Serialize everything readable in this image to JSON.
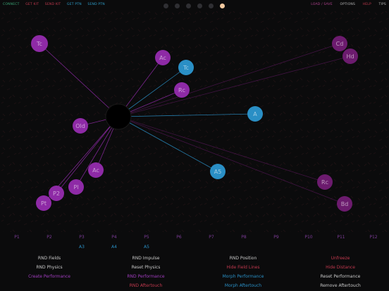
{
  "topbar": {
    "left": [
      {
        "label": "CONNECT",
        "color": "#3aa676"
      },
      {
        "label": "GET KIT",
        "color": "#c2394e"
      },
      {
        "label": "SEND KIT",
        "color": "#c2394e"
      },
      {
        "label": "GET PTN",
        "color": "#2f9fcc"
      },
      {
        "label": "SEND PTN",
        "color": "#2f9fcc"
      }
    ],
    "right": [
      {
        "label": "LOAD / SAVE",
        "color": "#b0428f"
      },
      {
        "label": "OPTIONS",
        "color": "#b8b8b8"
      },
      {
        "label": "HELP",
        "color": "#c2394e"
      },
      {
        "label": "TIPS",
        "color": "#b8b8b8"
      }
    ],
    "page_dots": [
      false,
      false,
      false,
      false,
      false,
      true
    ]
  },
  "center_hub": {
    "color": "#000000"
  },
  "nodes": [
    {
      "id": "n1",
      "label": "Tc",
      "color": "#8e2aa6"
    },
    {
      "id": "n2",
      "label": "Ac",
      "color": "#8e2aa6"
    },
    {
      "id": "n3",
      "label": "Tc",
      "color": "#2a8fc5"
    },
    {
      "id": "n4",
      "label": "Rc",
      "color": "#8e2aa6"
    },
    {
      "id": "n5",
      "label": "Old",
      "color": "#8e2aa6"
    },
    {
      "id": "n6",
      "label": "A",
      "color": "#2a8fc5"
    },
    {
      "id": "n7",
      "label": "Ac",
      "color": "#8e2aa6"
    },
    {
      "id": "n8",
      "label": "Pl",
      "color": "#8e2aa6"
    },
    {
      "id": "n9",
      "label": "P2",
      "color": "#8e2aa6"
    },
    {
      "id": "n10",
      "label": "Pt",
      "color": "#8e2aa6"
    },
    {
      "id": "n11",
      "label": "A5",
      "color": "#2a8fc5"
    },
    {
      "id": "n12",
      "label": "Cd",
      "color": "#6c1b6e"
    },
    {
      "id": "n13",
      "label": "Hd",
      "color": "#6c1b6e"
    },
    {
      "id": "n14",
      "label": "Rc",
      "color": "#6c1b6e"
    },
    {
      "id": "n15",
      "label": "Bd",
      "color": "#6c1b6e"
    }
  ],
  "p_labels": [
    "P1",
    "P2",
    "P3",
    "P4",
    "P5",
    "P6",
    "P7",
    "P8",
    "P9",
    "P10",
    "P11",
    "P12"
  ],
  "a_labels": [
    {
      "label": "A3",
      "color": "#2a8fc5"
    },
    {
      "label": "A4",
      "color": "#2a8fc5"
    },
    {
      "label": "A5",
      "color": "#2a8fc5"
    }
  ],
  "controls": {
    "rnd_fields": "RND Fields",
    "rnd_physics": "RND Physics",
    "create_performance": "Create Performance",
    "rnd_impulse": "RND Impulse",
    "reset_physics": "Reset Physics",
    "rnd_performance": "RND Performance",
    "rnd_aftertouch": "RND Aftertouch",
    "rnd_position": "RND Position",
    "hide_field_lines": "Hide Field Lines",
    "morph_performance": "Morph Performance",
    "morph_aftertouch": "Morph Aftertouch",
    "unfreeze": "Unfreeze",
    "hide_distance": "Hide Distance",
    "reset_performance": "Reset Performance",
    "remove_aftertouch": "Remove Aftertouch"
  },
  "colors": {
    "white": "#c9c9c9",
    "purple": "#a13dbf",
    "red": "#c2394e",
    "blue": "#2a8fc5",
    "pink": "#b0428f"
  }
}
